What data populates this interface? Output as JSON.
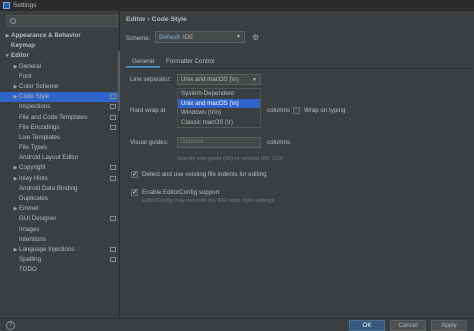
{
  "window": {
    "title": "Settings"
  },
  "sidebar": {
    "items": [
      {
        "label": "Appearance & Behavior",
        "arrow": "▶",
        "bold": true,
        "indent": 0
      },
      {
        "label": "Keymap",
        "arrow": "",
        "bold": true,
        "indent": 0
      },
      {
        "label": "Editor",
        "arrow": "▼",
        "bold": true,
        "indent": 0
      },
      {
        "label": "General",
        "arrow": "▶",
        "bold": false,
        "indent": 1
      },
      {
        "label": "Font",
        "arrow": "",
        "bold": false,
        "indent": 1
      },
      {
        "label": "Color Scheme",
        "arrow": "▶",
        "bold": false,
        "indent": 1
      },
      {
        "label": "Code Style",
        "arrow": "▶",
        "bold": false,
        "indent": 1,
        "selected": true,
        "projIcon": true
      },
      {
        "label": "Inspections",
        "arrow": "",
        "bold": false,
        "indent": 1,
        "projIcon": true
      },
      {
        "label": "File and Code Templates",
        "arrow": "",
        "bold": false,
        "indent": 1,
        "projIcon": true
      },
      {
        "label": "File Encodings",
        "arrow": "",
        "bold": false,
        "indent": 1,
        "projIcon": true
      },
      {
        "label": "Live Templates",
        "arrow": "",
        "bold": false,
        "indent": 1
      },
      {
        "label": "File Types",
        "arrow": "",
        "bold": false,
        "indent": 1
      },
      {
        "label": "Android Layout Editor",
        "arrow": "",
        "bold": false,
        "indent": 1
      },
      {
        "label": "Copyright",
        "arrow": "▶",
        "bold": false,
        "indent": 1,
        "projIcon": true
      },
      {
        "label": "Inlay Hints",
        "arrow": "▶",
        "bold": false,
        "indent": 1,
        "projIcon": true
      },
      {
        "label": "Android Data Binding",
        "arrow": "",
        "bold": false,
        "indent": 1
      },
      {
        "label": "Duplicates",
        "arrow": "",
        "bold": false,
        "indent": 1
      },
      {
        "label": "Emmet",
        "arrow": "▶",
        "bold": false,
        "indent": 1
      },
      {
        "label": "GUI Designer",
        "arrow": "",
        "bold": false,
        "indent": 1,
        "projIcon": true
      },
      {
        "label": "Images",
        "arrow": "",
        "bold": false,
        "indent": 1
      },
      {
        "label": "Intentions",
        "arrow": "",
        "bold": false,
        "indent": 1
      },
      {
        "label": "Language Injections",
        "arrow": "▶",
        "bold": false,
        "indent": 1,
        "projIcon": true
      },
      {
        "label": "Spelling",
        "arrow": "",
        "bold": false,
        "indent": 1,
        "projIcon": true
      },
      {
        "label": "TODO",
        "arrow": "",
        "bold": false,
        "indent": 1
      }
    ]
  },
  "main": {
    "breadcrumb": "Editor  ›  Code Style",
    "scheme": {
      "label": "Scheme:",
      "name": "Default",
      "scope": "IDE"
    },
    "tabs": [
      {
        "label": "General"
      },
      {
        "label": "Formatter Control"
      }
    ],
    "line_separator": {
      "label": "Line separator:",
      "value": "Unix and macOS (\\n)",
      "options": [
        "System-Dependent",
        "Unix and macOS (\\n)",
        "Windows (\\r\\n)",
        "Classic macOS (\\r)"
      ],
      "selected_index": 1
    },
    "hard_wrap": {
      "label": "Hard wrap at",
      "unit": "columns",
      "wrap_on_typing": "Wrap on typing"
    },
    "visual_guides": {
      "label": "Visual guides:",
      "placeholder": "Optional",
      "unit": "columns",
      "hint": "Specify one guide (80) or several (80, 120)"
    },
    "detect_indents": {
      "label": "Detect and use existing file indents for editing",
      "checked": true
    },
    "editorconfig": {
      "label": "Enable EditorConfig support",
      "hint": "EditorConfig may override the IDE code style settings",
      "checked": true
    }
  },
  "footer": {
    "help": "?",
    "ok": "OK",
    "cancel": "Cancel",
    "apply": "Apply"
  }
}
